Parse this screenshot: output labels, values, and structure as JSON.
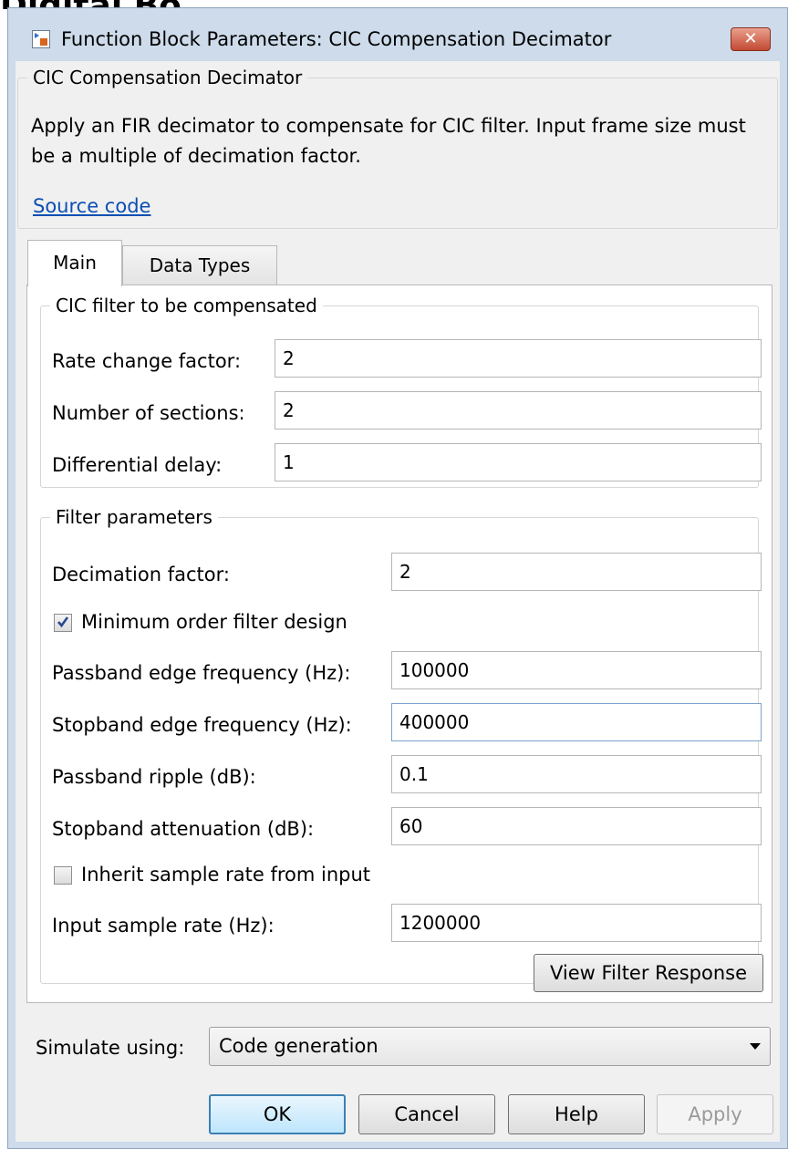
{
  "background": {
    "text": "Digital Bo"
  },
  "window": {
    "title": "Function Block Parameters: CIC Compensation Decimator",
    "close_label": "✕"
  },
  "block": {
    "name": "CIC Compensation Decimator",
    "description": "Apply an FIR decimator to compensate for CIC filter. Input frame size must be a multiple of decimation factor.",
    "source_link": "Source code"
  },
  "tabs": [
    {
      "label": "Main",
      "active": true
    },
    {
      "label": "Data Types",
      "active": false
    }
  ],
  "cic_group": {
    "title": "CIC filter to be compensated",
    "rate_change": {
      "label": "Rate change factor:",
      "value": "2"
    },
    "sections": {
      "label": "Number of sections:",
      "value": "2"
    },
    "diff_delay": {
      "label": "Differential delay:",
      "value": "1"
    }
  },
  "filter_group": {
    "title": "Filter parameters",
    "decimation": {
      "label": "Decimation factor:",
      "value": "2"
    },
    "min_order": {
      "label": "Minimum order filter design",
      "checked": true
    },
    "passband_edge": {
      "label": "Passband edge frequency (Hz):",
      "value": "100000"
    },
    "stopband_edge": {
      "label": "Stopband edge frequency (Hz):",
      "value": "400000"
    },
    "passband_ripple": {
      "label": "Passband ripple (dB):",
      "value": "0.1"
    },
    "stopband_atten": {
      "label": "Stopband attenuation (dB):",
      "value": "60"
    },
    "inherit_rate": {
      "label": "Inherit sample rate from input",
      "checked": false
    },
    "input_rate": {
      "label": "Input sample rate (Hz):",
      "value": "1200000"
    },
    "view_response": "View Filter Response"
  },
  "simulate": {
    "label": "Simulate using:",
    "value": "Code generation"
  },
  "buttons": {
    "ok": "OK",
    "cancel": "Cancel",
    "help": "Help",
    "apply": "Apply"
  },
  "colors": {
    "link": "#0b4fb3",
    "titlebar": "#cddbea",
    "close": "#c24a33",
    "check": "#2a4a8f"
  }
}
